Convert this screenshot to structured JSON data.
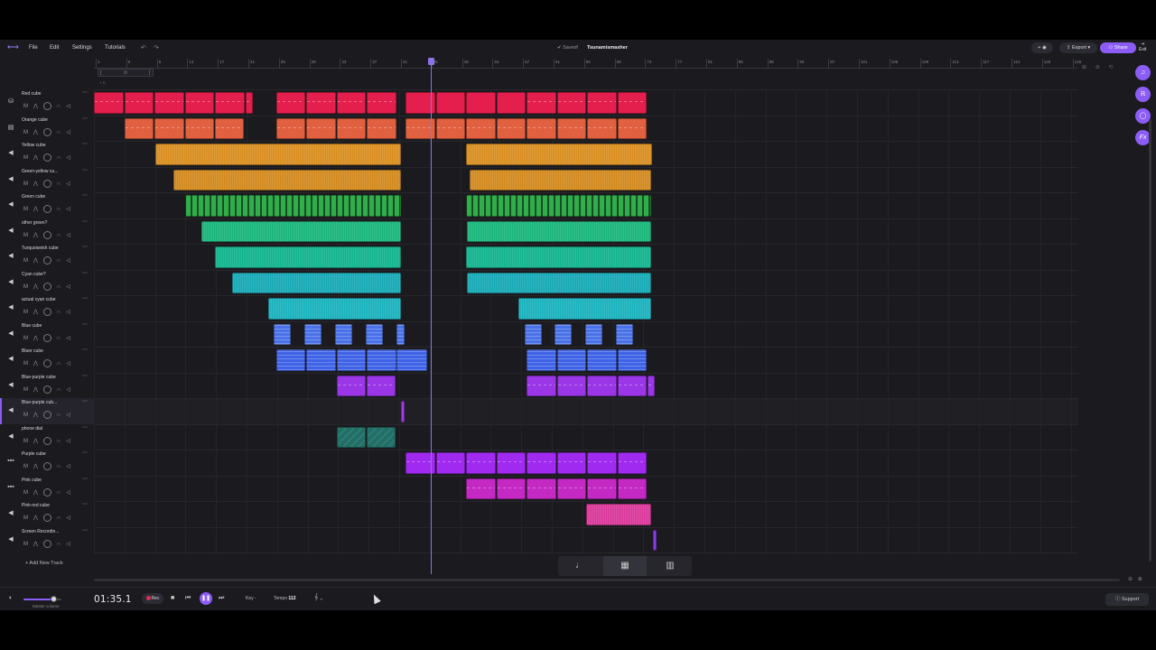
{
  "topbar": {
    "menu": [
      "File",
      "Edit",
      "Settings",
      "Tutorials"
    ],
    "saved_label": "Saved!",
    "project_title": "Tsunamismasher",
    "export_label": "Export",
    "share_label": "Share",
    "exit_label": "Exit"
  },
  "ruler": {
    "ticks": [
      "1",
      "5",
      "9",
      "13",
      "17",
      "21",
      "25",
      "29",
      "33",
      "37",
      "41",
      "45",
      "49",
      "53",
      "57",
      "61",
      "65",
      "69",
      "73",
      "77",
      "81",
      "85",
      "89",
      "93",
      "97",
      "101",
      "105",
      "109",
      "113",
      "117",
      "121",
      "125",
      "129"
    ]
  },
  "tracks": [
    {
      "name": "Red cube",
      "icon": "drum-icon",
      "color": "#e41f4d"
    },
    {
      "name": "Orange cube",
      "icon": "keys-icon",
      "color": "#e0603f"
    },
    {
      "name": "Yellow cube",
      "icon": "speaker-icon",
      "color": "#d98d1e"
    },
    {
      "name": "Green-yellow cu...",
      "icon": "speaker-icon",
      "color": "#d2891c"
    },
    {
      "name": "Green cube",
      "icon": "speaker-icon",
      "color": "#2fae4a"
    },
    {
      "name": "other green?",
      "icon": "speaker-icon",
      "color": "#17b57a"
    },
    {
      "name": "Turquoiseish cube",
      "icon": "speaker-icon",
      "color": "#10b38d"
    },
    {
      "name": "Cyan cube?",
      "icon": "speaker-icon",
      "color": "#15a9b5"
    },
    {
      "name": "actual cyan cube",
      "icon": "speaker-icon",
      "color": "#17b2bd"
    },
    {
      "name": "Blue cube",
      "icon": "speaker-icon",
      "color": "#4a72e8"
    },
    {
      "name": "Bluer cube",
      "icon": "speaker-icon",
      "color": "#3f63e6"
    },
    {
      "name": "Blue-purple cube",
      "icon": "speaker-icon",
      "color": "#9a36e6"
    },
    {
      "name": "Blue-purple cub...",
      "icon": "speaker-icon",
      "color": "#a13ce8"
    },
    {
      "name": "phone dial",
      "icon": "speaker-icon",
      "color": "#1f6f66"
    },
    {
      "name": "Purple cube",
      "icon": "synth-icon",
      "color": "#a12af0"
    },
    {
      "name": "Pink cube",
      "icon": "synth-icon",
      "color": "#c429c4"
    },
    {
      "name": "Pink-red cube",
      "icon": "speaker-icon",
      "color": "#d9379a"
    },
    {
      "name": "Screen Recordin...",
      "icon": "speaker-icon",
      "color": "#8b3ce8"
    }
  ],
  "add_track_label": "+ Add New Track",
  "transport": {
    "time": "01:35.1",
    "rec_label": "Rec",
    "key_label": "Key",
    "tempo_label": "Tempo",
    "tempo_value": "112",
    "master_volume_label": "Master volume",
    "master_volume": 0.8,
    "support_label": "Support"
  },
  "colors": {
    "accent": "#8b5cf6",
    "background": "#1b1b1f"
  }
}
